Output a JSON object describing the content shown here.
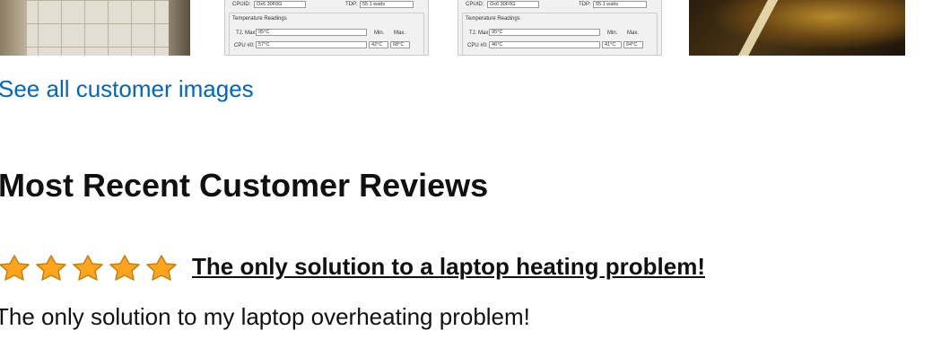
{
  "customer_images": {
    "thumbnails": [
      {
        "name": "tile-floor-photo"
      },
      {
        "name": "cpu-monitor-screenshot-1",
        "cpu_id_label": "CPUID:",
        "cpu_id_value": "Ox6 30F0G",
        "tdp_label": "TDP:",
        "tdp_value": "55.1 watts",
        "section_title": "Temperature Readings",
        "tj_label": "TJ. Max:",
        "tj_value": "95°C",
        "core_label": "CPU #0:",
        "core_value": "57°C",
        "min_label": "Min.",
        "max_label": "Max.",
        "min_value": "42°C",
        "max_value": "68°C"
      },
      {
        "name": "cpu-monitor-screenshot-2",
        "cpu_id_label": "CPUID:",
        "cpu_id_value": "Ox6 30F0G",
        "tdp_label": "TDP:",
        "tdp_value": "55.1 watts",
        "section_title": "Temperature Readings",
        "tj_label": "TJ. Max:",
        "tj_value": "95°C",
        "core_label": "CPU #0:",
        "core_value": "46°C",
        "min_label": "Min.",
        "max_label": "Max.",
        "min_value": "41°C",
        "max_value": "64°C"
      },
      {
        "name": "dark-photo"
      }
    ],
    "see_all_label": "See all customer images"
  },
  "reviews_section": {
    "heading": "Most Recent Customer Reviews",
    "reviews": [
      {
        "rating": 5,
        "max_rating": 5,
        "star_color": "#ffa41c",
        "title": "The only solution to a laptop heating problem!",
        "body": "The only solution to my laptop overheating problem!"
      }
    ]
  },
  "colors": {
    "link": "#0066c0",
    "text": "#111111",
    "star": "#ffa41c"
  }
}
